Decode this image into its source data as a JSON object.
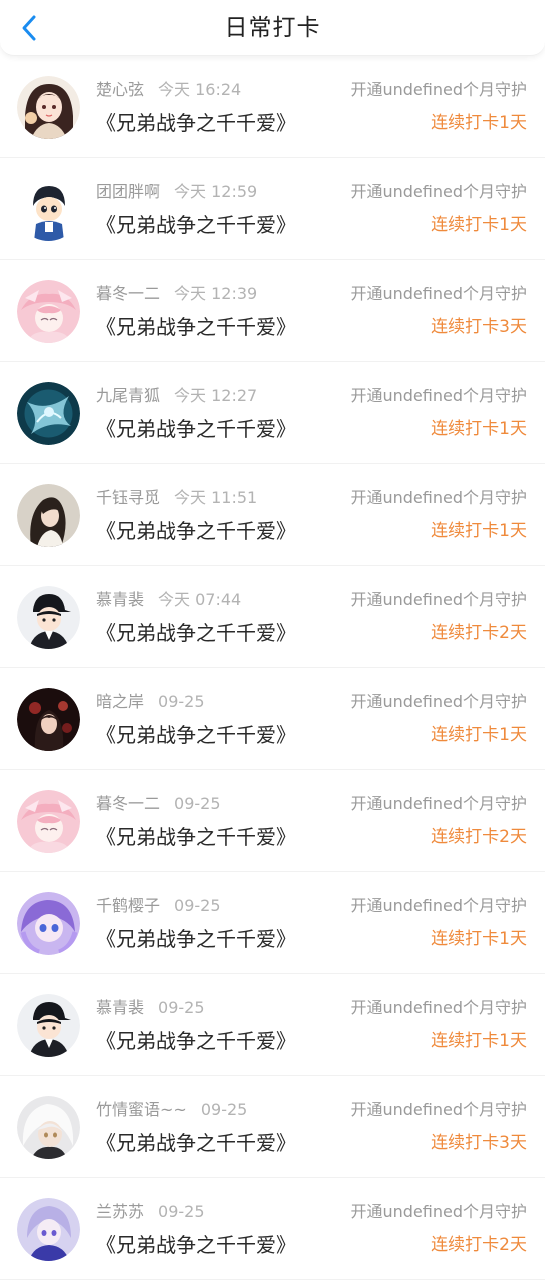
{
  "header": {
    "title": "日常打卡"
  },
  "colors": {
    "accent": "#1a8cf0",
    "streak": "#ef8a3c",
    "muted": "#9a9a9a"
  },
  "list": [
    {
      "name": "楚心弦",
      "time": "今天 16:24",
      "book": "《兄弟战争之千千爱》",
      "open": "开通undefined个月守护",
      "streak": "连续打卡1天",
      "avatar": "anime-girl-avatar"
    },
    {
      "name": "团团胖啊",
      "time": "今天 12:59",
      "book": "《兄弟战争之千千爱》",
      "open": "开通undefined个月守护",
      "streak": "连续打卡1天",
      "avatar": "cartoon-boy-avatar"
    },
    {
      "name": "暮冬一二",
      "time": "今天 12:39",
      "book": "《兄弟战争之千千爱》",
      "open": "开通undefined个月守护",
      "streak": "连续打卡3天",
      "avatar": "pink-hair-avatar"
    },
    {
      "name": "九尾青狐",
      "time": "今天 12:27",
      "book": "《兄弟战争之千千爱》",
      "open": "开通undefined个月守护",
      "streak": "连续打卡1天",
      "avatar": "blue-fox-avatar"
    },
    {
      "name": "千钰寻觅",
      "time": "今天 11:51",
      "book": "《兄弟战争之千千爱》",
      "open": "开通undefined个月守护",
      "streak": "连续打卡1天",
      "avatar": "girl-photo-avatar"
    },
    {
      "name": "慕青裴",
      "time": "今天 07:44",
      "book": "《兄弟战争之千千爱》",
      "open": "开通undefined个月守护",
      "streak": "连续打卡2天",
      "avatar": "cap-boy-avatar"
    },
    {
      "name": "暗之岸",
      "time": "09-25",
      "book": "《兄弟战争之千千爱》",
      "open": "开通undefined个月守护",
      "streak": "连续打卡1天",
      "avatar": "dark-red-avatar"
    },
    {
      "name": "暮冬一二",
      "time": "09-25",
      "book": "《兄弟战争之千千爱》",
      "open": "开通undefined个月守护",
      "streak": "连续打卡2天",
      "avatar": "pink-hair-avatar"
    },
    {
      "name": "千鹤樱子",
      "time": "09-25",
      "book": "《兄弟战争之千千爱》",
      "open": "开通undefined个月守护",
      "streak": "连续打卡1天",
      "avatar": "purple-hair-avatar"
    },
    {
      "name": "慕青裴",
      "time": "09-25",
      "book": "《兄弟战争之千千爱》",
      "open": "开通undefined个月守护",
      "streak": "连续打卡1天",
      "avatar": "cap-boy-avatar"
    },
    {
      "name": "竹情蜜语~~",
      "time": "09-25",
      "book": "《兄弟战争之千千爱》",
      "open": "开通undefined个月守护",
      "streak": "连续打卡3天",
      "avatar": "white-hair-avatar"
    },
    {
      "name": "兰苏苏",
      "time": "09-25",
      "book": "《兄弟战争之千千爱》",
      "open": "开通undefined个月守护",
      "streak": "连续打卡2天",
      "avatar": "lavender-hair-avatar"
    }
  ]
}
